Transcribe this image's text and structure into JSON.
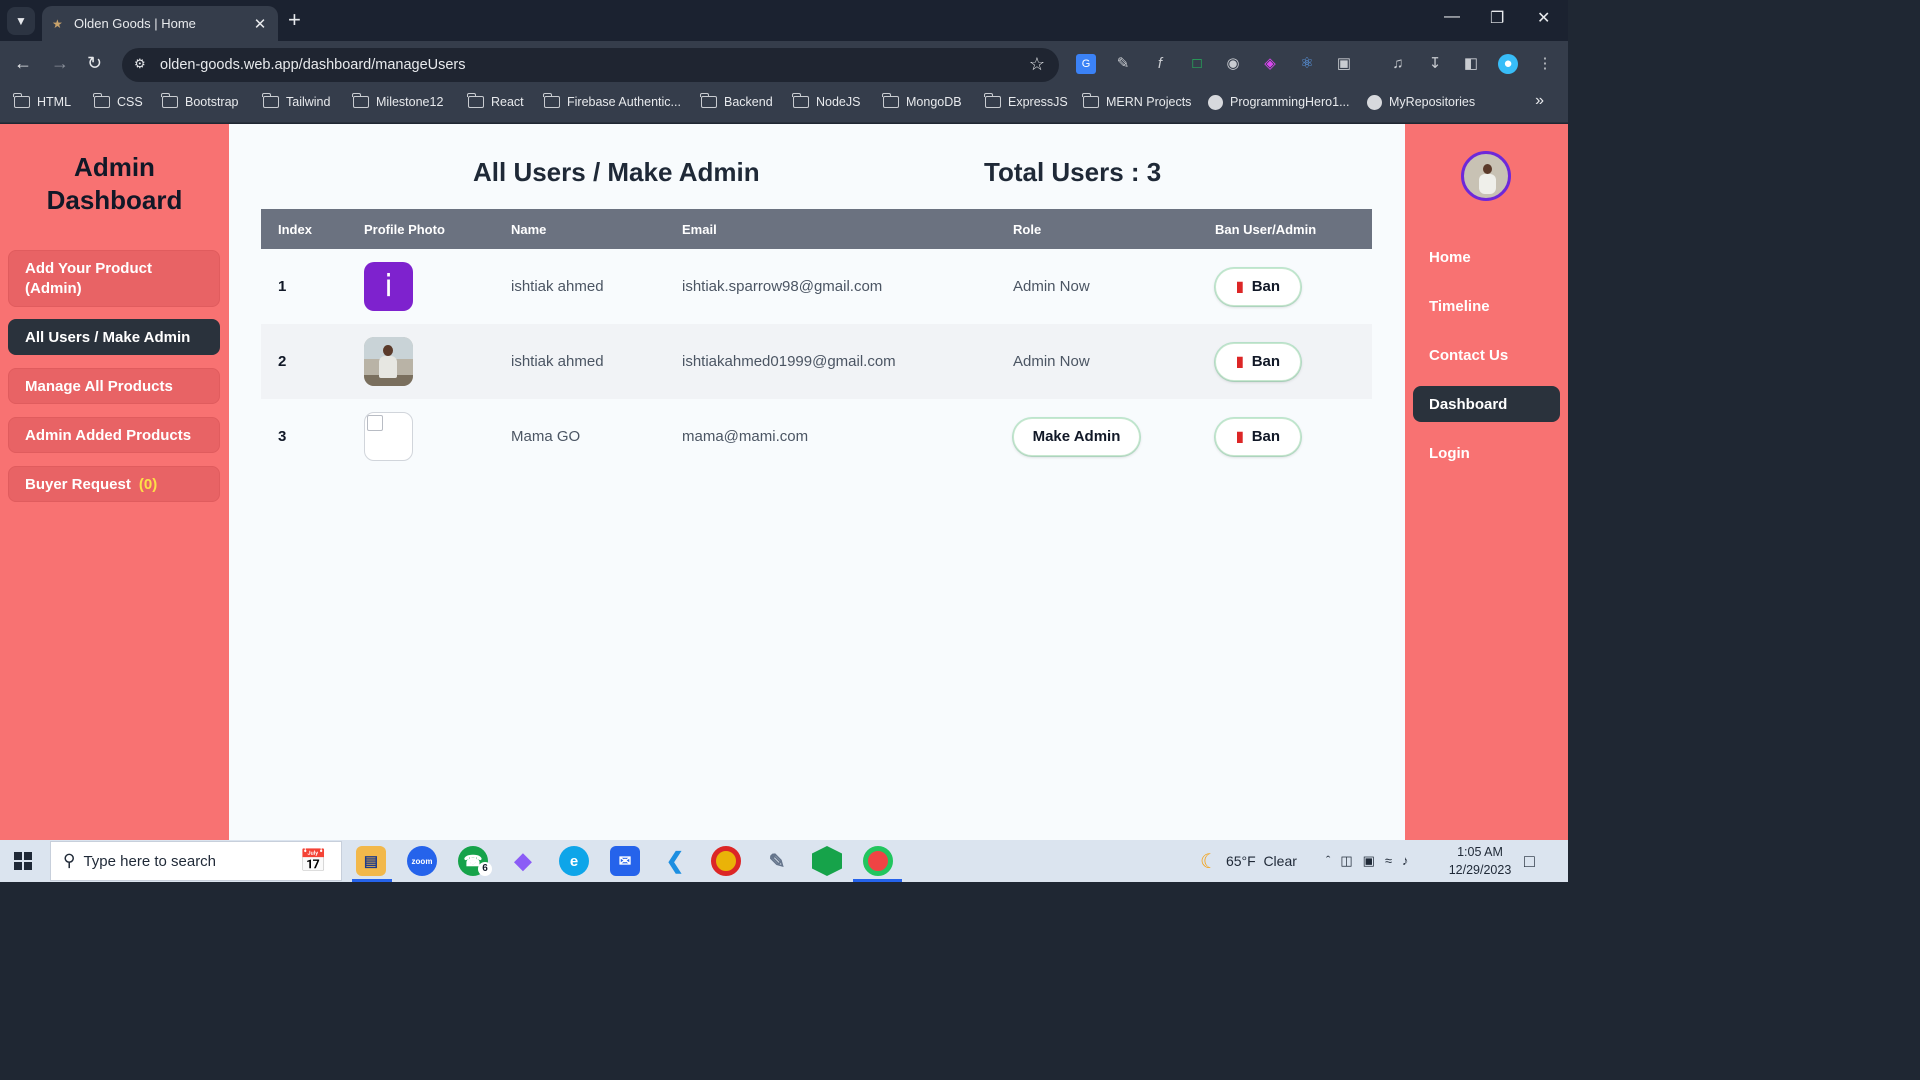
{
  "browser": {
    "tab_title": "Olden Goods | Home",
    "url": "olden-goods.web.app/dashboard/manageUsers",
    "bookmarks": [
      "HTML",
      "CSS",
      "Bootstrap",
      "Tailwind",
      "Milestone12",
      "React",
      "Firebase Authentic...",
      "Backend",
      "NodeJS",
      "MongoDB",
      "ExpressJS",
      "MERN Projects",
      "ProgrammingHero1...",
      "MyRepositories"
    ]
  },
  "sidebar": {
    "title": "Admin Dashboard",
    "items": [
      {
        "label": "Add Your Product (Admin)"
      },
      {
        "label": "All Users / Make Admin"
      },
      {
        "label": "Manage All Products"
      },
      {
        "label": "Admin Added Products"
      },
      {
        "label": "Buyer Request",
        "count": "(0)"
      }
    ]
  },
  "main": {
    "heading": "All Users / Make Admin",
    "total": "Total Users : 3",
    "columns": [
      "Index",
      "Profile Photo",
      "Name",
      "Email",
      "Role",
      "Ban User/Admin"
    ],
    "rows": [
      {
        "index": "1",
        "avatar_letter": "i",
        "name": "ishtiak ahmed",
        "email": "ishtiak.sparrow98@gmail.com",
        "role": "Admin Now",
        "ban": "Ban"
      },
      {
        "index": "2",
        "name": "ishtiak ahmed",
        "email": "ishtiakahmed01999@gmail.com",
        "role": "Admin Now",
        "ban": "Ban"
      },
      {
        "index": "3",
        "name": "Mama GO",
        "email": "mama@mami.com",
        "role": "Make Admin",
        "ban": "Ban"
      }
    ]
  },
  "right_nav": {
    "items": [
      {
        "label": "Home"
      },
      {
        "label": "Timeline"
      },
      {
        "label": "Contact Us"
      },
      {
        "label": "Dashboard"
      },
      {
        "label": "Login"
      }
    ]
  },
  "taskbar": {
    "search_placeholder": "Type here to search",
    "whatsapp_badge": "6",
    "weather": "65°F  Clear",
    "time": "1:05 AM",
    "date": "12/29/2023"
  },
  "colors": {
    "sidebar_bg": "#f87272",
    "active_item": "#2a323c",
    "table_header": "#6b7280",
    "count_highlight": "#fde047"
  }
}
